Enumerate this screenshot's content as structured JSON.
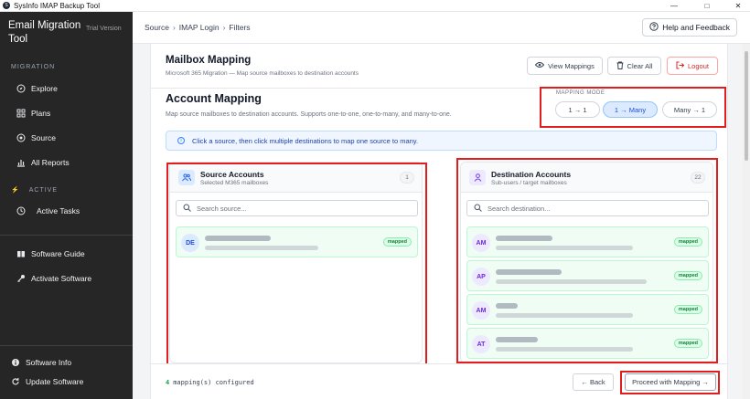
{
  "window": {
    "title": "SysInfo IMAP Backup Tool",
    "minimize": "—",
    "maximize": "□",
    "close": "✕"
  },
  "sidebar": {
    "brand": "Email Migration Tool",
    "edition": "Trial Version",
    "sections": {
      "migration": "MIGRATION",
      "active": "ACTIVE"
    },
    "items": [
      {
        "label": "Explore",
        "icon": "compass-icon"
      },
      {
        "label": "Plans",
        "icon": "grid-icon"
      },
      {
        "label": "Source",
        "icon": "target-icon"
      },
      {
        "label": "All Reports",
        "icon": "chart-icon"
      },
      {
        "label": "Active Tasks",
        "icon": "clock-icon"
      },
      {
        "label": "Software Guide",
        "icon": "book-icon"
      },
      {
        "label": "Activate Software",
        "icon": "key-icon"
      },
      {
        "label": "Software Info",
        "icon": "info-icon"
      },
      {
        "label": "Update Software",
        "icon": "refresh-icon"
      }
    ]
  },
  "topbar": {
    "breadcrumb": [
      "Source",
      "IMAP Login",
      "Filters"
    ],
    "help": "Help and Feedback"
  },
  "mailbox": {
    "title": "Mailbox Mapping",
    "subtitle": "Microsoft 365 Migration — Map source mailboxes to destination accounts",
    "view_mappings": "View Mappings",
    "clear_all": "Clear All",
    "logout": "Logout"
  },
  "account_mapping": {
    "title": "Account Mapping",
    "subtitle": "Map source mailboxes to destination accounts. Supports one-to-one, one-to-many, and many-to-one.",
    "mode_label": "MAPPING MODE",
    "modes": [
      {
        "label": "1 → 1",
        "active": false
      },
      {
        "label": "1 → Many",
        "active": true
      },
      {
        "label": "Many → 1",
        "active": false
      }
    ],
    "info": "Click a source, then click multiple destinations to map one source to many."
  },
  "source": {
    "title": "Source Accounts",
    "subtitle": "Selected M365 mailboxes",
    "count": "1",
    "search_placeholder": "Search source...",
    "rows": [
      {
        "initials": "DE",
        "badge": "mapped"
      }
    ]
  },
  "destination": {
    "title": "Destination Accounts",
    "subtitle": "Sub-users / target mailboxes",
    "count": "22",
    "search_placeholder": "Search destination...",
    "rows": [
      {
        "initials": "AM",
        "badge": "mapped"
      },
      {
        "initials": "AP",
        "badge": "mapped"
      },
      {
        "initials": "AM",
        "badge": "mapped"
      },
      {
        "initials": "AT",
        "badge": "mapped"
      }
    ]
  },
  "footer": {
    "count": "4",
    "count_text": "mapping(s) configured",
    "back": "← Back",
    "proceed": "Proceed with Mapping →"
  },
  "colors": {
    "accent": "#2563eb",
    "highlight": "#e11d1d",
    "mapped": "#15803d",
    "sidebar": "#262626"
  }
}
